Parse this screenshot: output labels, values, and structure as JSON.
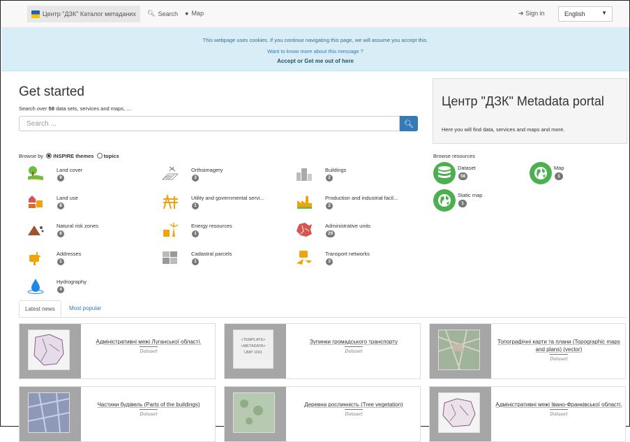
{
  "nav": {
    "brand": "Центр \"ДЗК\" Каталог метаданих",
    "search": "Search",
    "map": "Map",
    "signin": "Sign in",
    "language": "English"
  },
  "cookie": {
    "line1": "This webpage uses cookies. If you continue navigating this page, we will assume you accept this.",
    "line2": "Want to know more about this message ?",
    "accept": "Accept",
    "or": "or",
    "leave": "Get me out of here"
  },
  "get_started": {
    "title": "Get started",
    "subtitle_prefix": "Search over ",
    "count": "58",
    "subtitle_suffix": " data sets, services and maps, ...",
    "placeholder": "Search ..."
  },
  "portal": {
    "title": "Центр \"ДЗК\" Metadata portal",
    "subtitle": "Here you will find data, services and maps and more."
  },
  "browse": {
    "prefix": "Browse by",
    "inspire": "INSPIRE themes",
    "topics": "topics",
    "themes": [
      {
        "label": "Land cover",
        "count": "9",
        "icon": "land-cover-icon"
      },
      {
        "label": "Orthoimagery",
        "count": "3",
        "icon": "orthoimagery-icon"
      },
      {
        "label": "Buildings",
        "count": "2",
        "icon": "buildings-icon"
      },
      {
        "label": "Land use",
        "count": "8",
        "icon": "land-use-icon"
      },
      {
        "label": "Utility and governmental servi...",
        "count": "1",
        "icon": "utility-icon"
      },
      {
        "label": "Production and industrial facil...",
        "count": "2",
        "icon": "production-icon"
      },
      {
        "label": "Natural risk zones",
        "count": "6",
        "icon": "natural-risk-icon"
      },
      {
        "label": "Energy resources",
        "count": "1",
        "icon": "energy-icon"
      },
      {
        "label": "Administrative units",
        "count": "29",
        "icon": "admin-units-icon"
      },
      {
        "label": "Addresses",
        "count": "1",
        "icon": "addresses-icon"
      },
      {
        "label": "Cadastral parcels",
        "count": "1",
        "icon": "cadastral-icon"
      },
      {
        "label": "Transport networks",
        "count": "3",
        "icon": "transport-icon"
      },
      {
        "label": "Hydrography",
        "count": "4",
        "icon": "hydrography-icon"
      }
    ]
  },
  "resources": {
    "title": "Browse resources",
    "items": [
      {
        "label": "Dataset",
        "count": "58",
        "icon": "database-icon"
      },
      {
        "label": "Map",
        "count": "1",
        "icon": "globe-icon"
      },
      {
        "label": "Static map",
        "count": "1",
        "icon": "globe-icon"
      }
    ]
  },
  "tabs": {
    "latest": "Latest news",
    "popular": "Most popular"
  },
  "cards": [
    {
      "title": "Адміністративні межі Луганської області.",
      "type": "Dataset"
    },
    {
      "title": "Зупинки громадського транспорту",
      "type": "Dataset",
      "thumb_text": [
        "<TEMPLATE>",
        "<METADATA>",
        "UMP 1001"
      ]
    },
    {
      "title": "Топографічні карти та плани (Topographic maps and plans) (vector)",
      "type": "Dataset"
    },
    {
      "title": "Частини будівель (Parts of the buildings)",
      "type": "Dataset"
    },
    {
      "title": "Деревна рослинність (Tree vegetation)",
      "type": "Dataset"
    },
    {
      "title": "Адміністративні межі Івано-Франківської області.",
      "type": "Dataset"
    }
  ],
  "colors": {
    "accent": "#337ab7",
    "theme_icon": "#f0a30a",
    "resource": "#4caf50",
    "badge": "#777777",
    "cookie_bg": "#d9edf7"
  }
}
